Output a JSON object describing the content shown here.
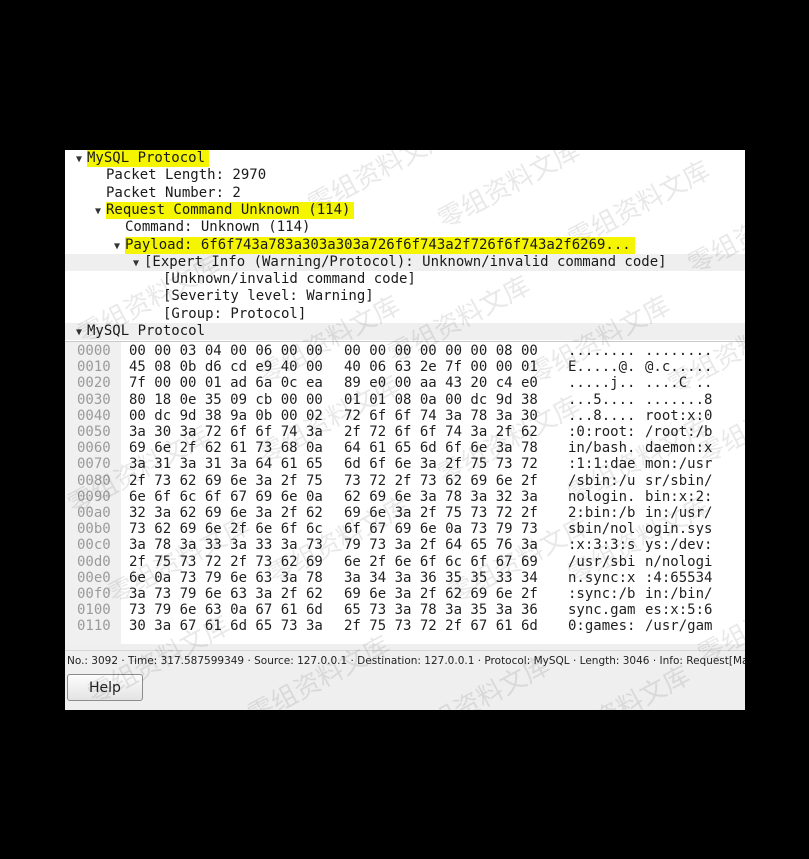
{
  "tree": [
    {
      "indent": 0,
      "twisty": "▼",
      "text": "MySQL Protocol",
      "style": "hl"
    },
    {
      "indent": 1,
      "twisty": "",
      "text": "Packet Length: 2970",
      "style": ""
    },
    {
      "indent": 1,
      "twisty": "",
      "text": "Packet Number: 2",
      "style": ""
    },
    {
      "indent": 1,
      "twisty": "▼",
      "text": "Request Command Unknown (114)",
      "style": "hl"
    },
    {
      "indent": 2,
      "twisty": "",
      "text": "Command: Unknown (114)",
      "style": ""
    },
    {
      "indent": 2,
      "twisty": "▼",
      "text": "Payload: 6f6f743a783a303a303a726f6f743a2f726f6f743a2f6269...",
      "style": "hl"
    },
    {
      "indent": 3,
      "twisty": "▼",
      "text": "[Expert Info (Warning/Protocol): Unknown/invalid command code]",
      "style": "exp"
    },
    {
      "indent": 4,
      "twisty": "",
      "text": "[Unknown/invalid command code]",
      "style": ""
    },
    {
      "indent": 4,
      "twisty": "",
      "text": "[Severity level: Warning]",
      "style": ""
    },
    {
      "indent": 4,
      "twisty": "",
      "text": "[Group: Protocol]",
      "style": ""
    },
    {
      "indent": 0,
      "twisty": "▼",
      "text": "MySQL Protocol",
      "style": "exp"
    }
  ],
  "hex_rows": [
    {
      "offset": "0000",
      "bytes1": "00 00 03 04 00 06 00 00",
      "bytes2": "00 00 00 00 00 00 08 00",
      "ascii1": "........",
      "ascii2": "........"
    },
    {
      "offset": "0010",
      "bytes1": "45 08 0b d6 cd e9 40 00",
      "bytes2": "40 06 63 2e 7f 00 00 01",
      "ascii1": "E.....@.",
      "ascii2": "@.c....."
    },
    {
      "offset": "0020",
      "bytes1": "7f 00 00 01 ad 6a 0c ea",
      "bytes2": "89 e0 00 aa 43 20 c4 e0",
      "ascii1": ".....j..",
      "ascii2": "....C .."
    },
    {
      "offset": "0030",
      "bytes1": "80 18 0e 35 09 cb 00 00",
      "bytes2": "01 01 08 0a 00 dc 9d 38",
      "ascii1": "...5....",
      "ascii2": ".......8"
    },
    {
      "offset": "0040",
      "bytes1": "00 dc 9d 38 9a 0b 00 02",
      "bytes2": "72 6f 6f 74 3a 78 3a 30",
      "ascii1": "...8....",
      "ascii2": "root:x:0"
    },
    {
      "offset": "0050",
      "bytes1": "3a 30 3a 72 6f 6f 74 3a",
      "bytes2": "2f 72 6f 6f 74 3a 2f 62",
      "ascii1": ":0:root:",
      "ascii2": "/root:/b"
    },
    {
      "offset": "0060",
      "bytes1": "69 6e 2f 62 61 73 68 0a",
      "bytes2": "64 61 65 6d 6f 6e 3a 78",
      "ascii1": "in/bash.",
      "ascii2": "daemon:x"
    },
    {
      "offset": "0070",
      "bytes1": "3a 31 3a 31 3a 64 61 65",
      "bytes2": "6d 6f 6e 3a 2f 75 73 72",
      "ascii1": ":1:1:dae",
      "ascii2": "mon:/usr"
    },
    {
      "offset": "0080",
      "bytes1": "2f 73 62 69 6e 3a 2f 75",
      "bytes2": "73 72 2f 73 62 69 6e 2f",
      "ascii1": "/sbin:/u",
      "ascii2": "sr/sbin/"
    },
    {
      "offset": "0090",
      "bytes1": "6e 6f 6c 6f 67 69 6e 0a",
      "bytes2": "62 69 6e 3a 78 3a 32 3a",
      "ascii1": "nologin.",
      "ascii2": "bin:x:2:"
    },
    {
      "offset": "00a0",
      "bytes1": "32 3a 62 69 6e 3a 2f 62",
      "bytes2": "69 6e 3a 2f 75 73 72 2f",
      "ascii1": "2:bin:/b",
      "ascii2": "in:/usr/"
    },
    {
      "offset": "00b0",
      "bytes1": "73 62 69 6e 2f 6e 6f 6c",
      "bytes2": "6f 67 69 6e 0a 73 79 73",
      "ascii1": "sbin/nol",
      "ascii2": "ogin.sys"
    },
    {
      "offset": "00c0",
      "bytes1": "3a 78 3a 33 3a 33 3a 73",
      "bytes2": "79 73 3a 2f 64 65 76 3a",
      "ascii1": ":x:3:3:s",
      "ascii2": "ys:/dev:"
    },
    {
      "offset": "00d0",
      "bytes1": "2f 75 73 72 2f 73 62 69",
      "bytes2": "6e 2f 6e 6f 6c 6f 67 69",
      "ascii1": "/usr/sbi",
      "ascii2": "n/nologi"
    },
    {
      "offset": "00e0",
      "bytes1": "6e 0a 73 79 6e 63 3a 78",
      "bytes2": "3a 34 3a 36 35 35 33 34",
      "ascii1": "n.sync:x",
      "ascii2": ":4:65534"
    },
    {
      "offset": "00f0",
      "bytes1": "3a 73 79 6e 63 3a 2f 62",
      "bytes2": "69 6e 3a 2f 62 69 6e 2f",
      "ascii1": ":sync:/b",
      "ascii2": "in:/bin/"
    },
    {
      "offset": "0100",
      "bytes1": "73 79 6e 63 0a 67 61 6d",
      "bytes2": "65 73 3a 78 3a 35 3a 36",
      "ascii1": "sync.gam",
      "ascii2": "es:x:5:6"
    },
    {
      "offset": "0110",
      "bytes1": "30 3a 67 61 6d 65 73 3a",
      "bytes2": "2f 75 73 72 2f 67 61 6d",
      "ascii1": "0:games:",
      "ascii2": "/usr/gam"
    }
  ],
  "status_bar": "No.: 3092 · Time: 317.587599349 · Source: 127.0.0.1 · Destination: 127.0.0.1 · Protocol: MySQL · Length: 3046 · Info: Request[Malformed Packet]",
  "help_label": "Help",
  "watermark": "零组资料文库",
  "colors": {
    "highlight": "#f5f500",
    "offset_gray": "#9a9a9a",
    "background": "#000000"
  }
}
